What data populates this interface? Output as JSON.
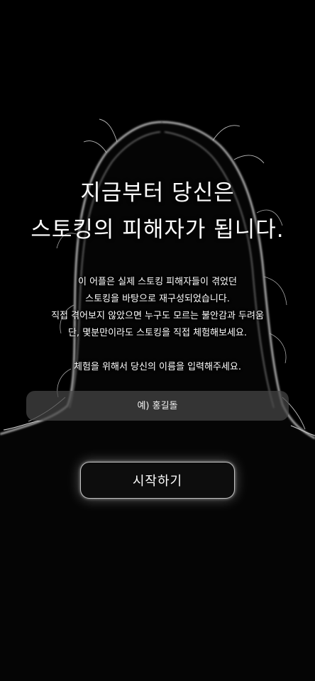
{
  "intro": {
    "title_lines": [
      "지금부터 당신은",
      "스토킹의 피해자가 됩니다."
    ],
    "description_lines": [
      "이 어플은 실제 스토킹 피해자들이 겪었던",
      "스토킹을 바탕으로 재구성되었습니다.",
      "직접 겪어보지 않았으면 누구도 모르는 불안감과 두려움",
      "단, 몇분만이라도 스토킹을 직접 체험해보세요."
    ],
    "prompt": "체험을 위해서 당신의 이름을 입력해주세요.",
    "name_input": {
      "placeholder": "예) 홍길돌",
      "value": ""
    },
    "start_button_label": "시작하기"
  },
  "colors": {
    "background": "#000000",
    "text": "#ffffff",
    "input_background": "#464646",
    "button_glow": "#ffffff"
  }
}
